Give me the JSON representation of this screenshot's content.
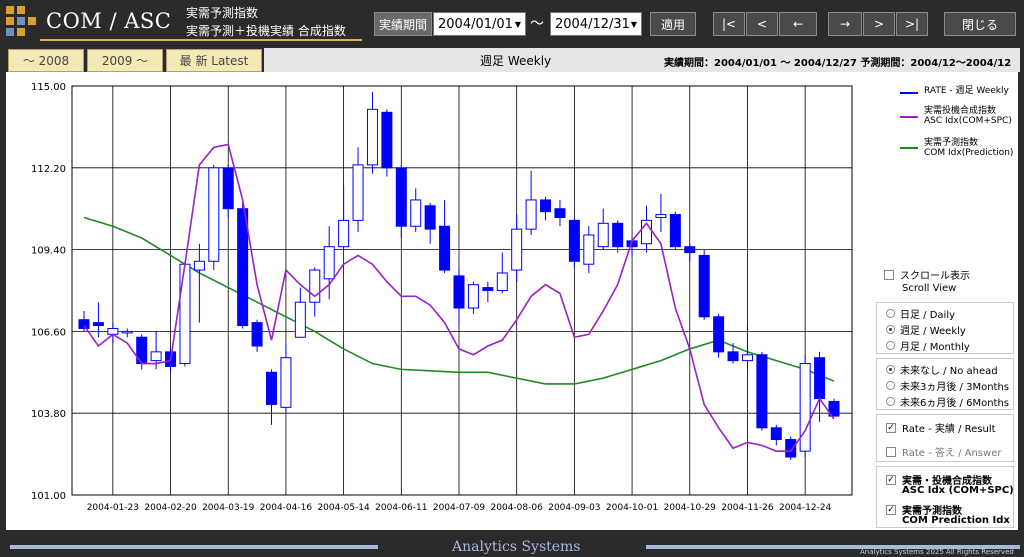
{
  "header": {
    "app_title": "COM / ASC",
    "subtitle_line1": "実需予測指数",
    "subtitle_line2": "実需予測＋投機実績 合成指数",
    "period_label": "実績期間",
    "date_from": "2004/01/01",
    "date_to": "2004/12/31",
    "tilde": "～",
    "apply_label": "適用",
    "nav_first": "|<",
    "nav_prev_page": "<",
    "nav_prev": "←",
    "nav_next": "→",
    "nav_next_page": ">",
    "nav_last": ">|",
    "close_label": "閉じる"
  },
  "toolbar": {
    "btn_2008": "～ 2008",
    "btn_2009": "2009 ～",
    "btn_latest": "最 新  Latest",
    "chart_mode": "週足 Weekly",
    "period_info": "実績期間：2004/01/01 ～ 2004/12/27  予測期間：2004/12～2004/12"
  },
  "legend": {
    "rate_title": "RATE - 週足 Weekly",
    "asc_title1": "実需投機合成指数",
    "asc_title2": "ASC Idx(COM+SPC)",
    "com_title1": "実需予測指数",
    "com_title2": "COM Idx(Prediction)"
  },
  "options": {
    "scroll_jp": "スクロール表示",
    "scroll_en": "Scroll View",
    "daily": "日足 / Daily",
    "weekly": "週足 / Weekly",
    "monthly": "月足 / Monthly",
    "no_ahead": "未来なし / No ahead",
    "ahead3": "未来3ヵ月後 / 3Months",
    "ahead6": "未来6ヵ月後 / 6Months",
    "rate_result": "Rate - 実績 / Result",
    "rate_answer": "Rate - 答え / Answer",
    "asc_jp": "実需・投機合成指数",
    "asc_en": "ASC Idx (COM+SPC)",
    "com_jp": "実需予測指数",
    "com_en": "COM Prediction Idx"
  },
  "footer": {
    "title": "Analytics Systems",
    "copyright": "Analytics Systems 2025 All Rights Reserved"
  },
  "colors": {
    "rate": "#0000ff",
    "asc": "#9a20c8",
    "com": "#208a20",
    "accent": "#d9b24a"
  },
  "chart_data": {
    "type": "candlestick+line",
    "ylim": [
      101.0,
      115.0
    ],
    "y_ticks": [
      "115.00",
      "112.20",
      "109.40",
      "106.60",
      "103.80",
      "101.00"
    ],
    "x_tick_labels": [
      "2004-01-23",
      "2004-02-20",
      "2004-03-19",
      "2004-04-16",
      "2004-05-14",
      "2004-06-11",
      "2004-07-09",
      "2004-08-06",
      "2004-09-03",
      "2004-10-01",
      "2004-10-29",
      "2004-11-26",
      "2004-12-24"
    ],
    "candles": [
      {
        "o": 107.0,
        "c": 106.7,
        "h": 107.3,
        "l": 106.6
      },
      {
        "o": 106.9,
        "c": 106.8,
        "h": 107.6,
        "l": 106.4
      },
      {
        "o": 106.5,
        "c": 106.7,
        "h": 106.9,
        "l": 106.2
      },
      {
        "o": 106.6,
        "c": 106.6,
        "h": 106.7,
        "l": 106.4
      },
      {
        "o": 106.4,
        "c": 105.5,
        "h": 106.5,
        "l": 105.3
      },
      {
        "o": 105.6,
        "c": 105.9,
        "h": 106.6,
        "l": 105.3
      },
      {
        "o": 105.9,
        "c": 105.4,
        "h": 106.0,
        "l": 105.2
      },
      {
        "o": 105.5,
        "c": 108.9,
        "h": 109.0,
        "l": 105.4
      },
      {
        "o": 108.7,
        "c": 109.0,
        "h": 109.6,
        "l": 106.9
      },
      {
        "o": 109.0,
        "c": 112.2,
        "h": 112.3,
        "l": 108.7
      },
      {
        "o": 112.2,
        "c": 110.8,
        "h": 112.3,
        "l": 110.5
      },
      {
        "o": 110.8,
        "c": 106.8,
        "h": 111.0,
        "l": 106.7
      },
      {
        "o": 106.9,
        "c": 106.1,
        "h": 107.0,
        "l": 105.9
      },
      {
        "o": 105.2,
        "c": 104.1,
        "h": 105.3,
        "l": 103.4
      },
      {
        "o": 104.0,
        "c": 105.7,
        "h": 106.2,
        "l": 103.8
      },
      {
        "o": 106.4,
        "c": 107.6,
        "h": 108.1,
        "l": 106.4
      },
      {
        "o": 107.6,
        "c": 108.7,
        "h": 108.8,
        "l": 107.1
      },
      {
        "o": 108.4,
        "c": 109.5,
        "h": 110.2,
        "l": 107.7
      },
      {
        "o": 109.5,
        "c": 110.4,
        "h": 111.6,
        "l": 109.4
      },
      {
        "o": 110.4,
        "c": 112.3,
        "h": 112.9,
        "l": 110.0
      },
      {
        "o": 112.3,
        "c": 114.2,
        "h": 114.8,
        "l": 112.0
      },
      {
        "o": 114.1,
        "c": 112.2,
        "h": 114.2,
        "l": 111.9
      },
      {
        "o": 112.2,
        "c": 110.2,
        "h": 112.3,
        "l": 109.8
      },
      {
        "o": 110.2,
        "c": 111.1,
        "h": 111.5,
        "l": 110.0
      },
      {
        "o": 110.9,
        "c": 110.1,
        "h": 111.0,
        "l": 109.6
      },
      {
        "o": 110.2,
        "c": 108.7,
        "h": 111.1,
        "l": 108.6
      },
      {
        "o": 108.5,
        "c": 107.4,
        "h": 108.8,
        "l": 106.8
      },
      {
        "o": 107.4,
        "c": 108.2,
        "h": 108.3,
        "l": 107.2
      },
      {
        "o": 108.1,
        "c": 108.0,
        "h": 108.3,
        "l": 107.6
      },
      {
        "o": 108.0,
        "c": 108.6,
        "h": 109.3,
        "l": 107.9
      },
      {
        "o": 108.7,
        "c": 110.1,
        "h": 110.6,
        "l": 108.3
      },
      {
        "o": 110.1,
        "c": 111.1,
        "h": 112.1,
        "l": 109.9
      },
      {
        "o": 111.1,
        "c": 110.7,
        "h": 111.2,
        "l": 110.4
      },
      {
        "o": 110.8,
        "c": 110.5,
        "h": 111.1,
        "l": 110.2
      },
      {
        "o": 110.4,
        "c": 109.0,
        "h": 110.5,
        "l": 108.8
      },
      {
        "o": 108.9,
        "c": 109.9,
        "h": 110.2,
        "l": 108.6
      },
      {
        "o": 109.5,
        "c": 110.3,
        "h": 110.8,
        "l": 109.4
      },
      {
        "o": 110.3,
        "c": 109.5,
        "h": 110.4,
        "l": 109.3
      },
      {
        "o": 109.7,
        "c": 109.5,
        "h": 109.8,
        "l": 109.2
      },
      {
        "o": 109.6,
        "c": 110.4,
        "h": 110.9,
        "l": 109.3
      },
      {
        "o": 110.5,
        "c": 110.6,
        "h": 111.3,
        "l": 110.0
      },
      {
        "o": 110.6,
        "c": 109.5,
        "h": 110.7,
        "l": 109.4
      },
      {
        "o": 109.5,
        "c": 109.3,
        "h": 109.6,
        "l": 109.0
      },
      {
        "o": 109.2,
        "c": 107.1,
        "h": 109.4,
        "l": 107.0
      },
      {
        "o": 107.1,
        "c": 105.9,
        "h": 107.2,
        "l": 105.7
      },
      {
        "o": 105.9,
        "c": 105.6,
        "h": 106.2,
        "l": 105.5
      },
      {
        "o": 105.6,
        "c": 105.8,
        "h": 106.8,
        "l": 105.3
      },
      {
        "o": 105.8,
        "c": 103.3,
        "h": 105.9,
        "l": 103.2
      },
      {
        "o": 103.3,
        "c": 102.9,
        "h": 103.4,
        "l": 102.7
      },
      {
        "o": 102.9,
        "c": 102.3,
        "h": 103.0,
        "l": 102.2
      },
      {
        "o": 102.5,
        "c": 105.5,
        "h": 105.8,
        "l": 102.3
      },
      {
        "o": 105.7,
        "c": 104.3,
        "h": 105.9,
        "l": 103.5
      },
      {
        "o": 104.2,
        "c": 103.7,
        "h": 104.3,
        "l": 103.7
      }
    ],
    "series": [
      {
        "name": "RATE - 週足 Weekly",
        "type": "candlestick"
      },
      {
        "name": "ASC Idx(COM+SPC)",
        "values": [
          106.8,
          106.1,
          106.5,
          106.2,
          105.5,
          105.5,
          105.6,
          108.9,
          112.3,
          112.9,
          113.0,
          111.1,
          108.2,
          106.3,
          108.7,
          108.2,
          107.8,
          108.2,
          108.9,
          109.2,
          108.9,
          108.3,
          107.8,
          107.8,
          107.5,
          106.9,
          106.0,
          105.8,
          106.1,
          106.3,
          107.0,
          107.8,
          108.2,
          107.9,
          106.4,
          106.5,
          107.3,
          108.2,
          109.7,
          110.3,
          109.6,
          107.4,
          106.0,
          104.1,
          103.3,
          102.6,
          102.8,
          102.7,
          102.5,
          102.5,
          103.2,
          104.3,
          103.6
        ]
      },
      {
        "name": "COM Idx(Prediction)",
        "values": [
          110.5,
          null,
          110.2,
          null,
          109.8,
          null,
          109.2,
          null,
          108.6,
          null,
          108.1,
          null,
          107.6,
          null,
          107.1,
          null,
          106.6,
          null,
          106.0,
          null,
          105.5,
          null,
          105.3,
          null,
          105.25,
          null,
          105.2,
          null,
          105.2,
          null,
          105.0,
          null,
          104.8,
          null,
          104.8,
          null,
          105.0,
          null,
          105.3,
          null,
          105.6,
          null,
          106.0,
          null,
          106.3,
          null,
          105.9,
          null,
          105.6,
          null,
          105.3,
          null,
          104.9
        ]
      }
    ]
  }
}
